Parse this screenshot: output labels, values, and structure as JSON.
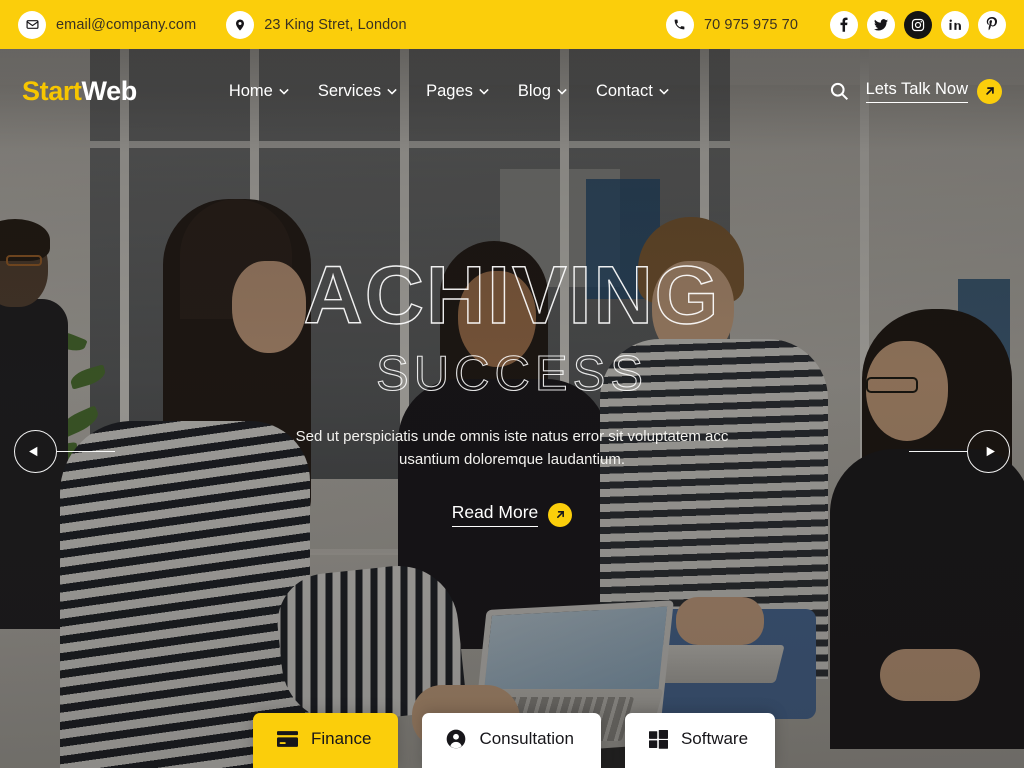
{
  "topbar": {
    "email": "email@company.com",
    "email_icon": "envelope-icon",
    "address": "23 King Stret, London",
    "address_icon": "location-pin-icon",
    "phone": "70 975 975 70",
    "phone_icon": "phone-icon",
    "background_color": "#fbce0b",
    "socials": [
      {
        "name": "facebook",
        "glyph": "f"
      },
      {
        "name": "twitter",
        "glyph": "bird"
      },
      {
        "name": "instagram",
        "glyph": "camera"
      },
      {
        "name": "linkedin",
        "glyph": "in"
      },
      {
        "name": "pinterest",
        "glyph": "P"
      }
    ]
  },
  "header": {
    "logo_part1": "Start",
    "logo_part2": "Web",
    "logo_color1": "#f7c600",
    "logo_color2": "#ffffff",
    "nav": [
      {
        "label": "Home",
        "has_dropdown": true
      },
      {
        "label": "Services",
        "has_dropdown": true
      },
      {
        "label": "Pages",
        "has_dropdown": true
      },
      {
        "label": "Blog",
        "has_dropdown": true
      },
      {
        "label": "Contact",
        "has_dropdown": true
      }
    ],
    "search_icon": "search-icon",
    "cta_label": "Lets Talk Now",
    "cta_icon": "arrow-up-right-icon",
    "cta_button_color": "#fbce0b"
  },
  "hero": {
    "title": "ACHIVING",
    "subtitle": "SUCCESS",
    "description": "Sed ut perspiciatis unde omnis iste natus error sit voluptatem acc usantium doloremque laudantium.",
    "read_more_label": "Read More",
    "read_more_icon": "arrow-up-right-icon",
    "prev_icon": "arrow-left-icon",
    "next_icon": "arrow-right-icon"
  },
  "service_tabs": [
    {
      "label": "Finance",
      "icon": "credit-card-icon",
      "active": true
    },
    {
      "label": "Consultation",
      "icon": "user-circle-icon",
      "active": false
    },
    {
      "label": "Software",
      "icon": "windows-icon",
      "active": false
    }
  ]
}
